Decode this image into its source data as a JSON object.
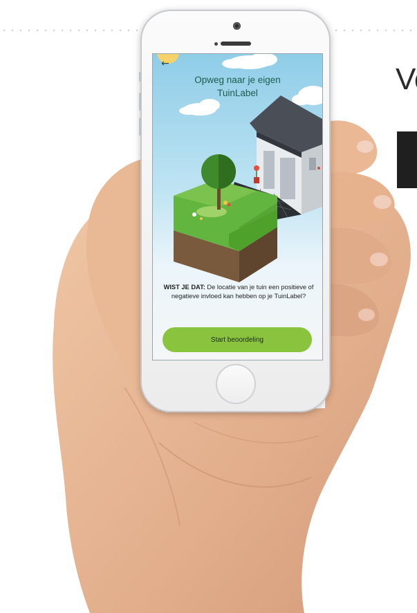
{
  "background": {
    "heading_partial": "Vo",
    "big_letter_partial": ""
  },
  "app": {
    "back_icon": "arrow-left-icon",
    "title": "Opweg naar je eigen TuinLabel",
    "fact_bold": "WIST JE DAT:",
    "fact_text": " De locatie van je tuin een positieve of negatieve invloed kan hebben op je TuinLabel?",
    "start_button": "Start beoordeling"
  },
  "colors": {
    "accent_green": "#8ac43f",
    "title_green": "#1e5c4d",
    "sky_blue": "#8fcde8"
  }
}
